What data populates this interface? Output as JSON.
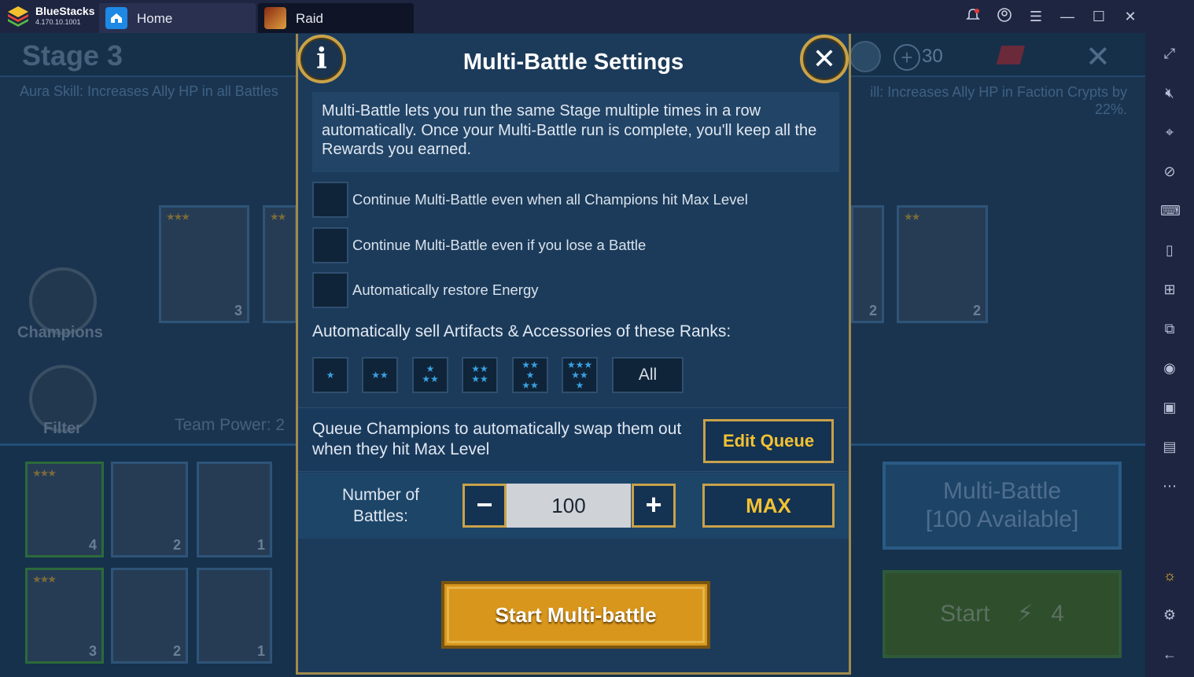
{
  "chrome": {
    "app_name": "BlueStacks",
    "app_version": "4.170.10.1001",
    "tabs": [
      {
        "label": "Home"
      },
      {
        "label": "Raid"
      }
    ]
  },
  "background": {
    "stage_title": "Stage 3",
    "aura_left": "Aura Skill: Increases Ally HP in all Battles",
    "aura_right": "ill: Increases Ally HP in Faction Crypts by 22%.",
    "currency_count": "30",
    "champions_label": "Champions",
    "filter_label": "Filter",
    "team_power_label": "Team Power: 2",
    "multi_battle_button": "Multi-Battle",
    "multi_battle_available": "[100 Available]",
    "start_label": "Start",
    "start_energy": "4",
    "hero_cards_top": [
      "3",
      "2",
      "2"
    ],
    "hero_cards_bottom": [
      "4",
      "2",
      "1",
      "3",
      "2",
      "1"
    ]
  },
  "modal": {
    "title": "Multi-Battle Settings",
    "description": "Multi-Battle lets you run the same Stage multiple times in a row automatically. Once your Multi-Battle run is complete, you'll keep all the Rewards you earned.",
    "options": [
      {
        "label": "Continue Multi-Battle even when all Champions hit Max Level",
        "checked": false
      },
      {
        "label": "Continue Multi-Battle even if you lose a Battle",
        "checked": false
      },
      {
        "label": "Automatically restore Energy",
        "checked": false
      }
    ],
    "sell_label": "Automatically sell Artifacts & Accessories of these Ranks:",
    "rank_all_label": "All",
    "queue_text": "Queue Champions to automatically swap them out when they hit Max Level",
    "edit_queue_label": "Edit Queue",
    "battles_label": "Number of Battles:",
    "battles_value": "100",
    "minus_label": "−",
    "plus_label": "+",
    "max_label": "MAX",
    "start_label": "Start Multi-battle"
  },
  "colors": {
    "gold": "#c9a24a",
    "gold_text": "#f3c233",
    "star_blue": "#3aa0e0",
    "start_button": "#d8961c"
  }
}
